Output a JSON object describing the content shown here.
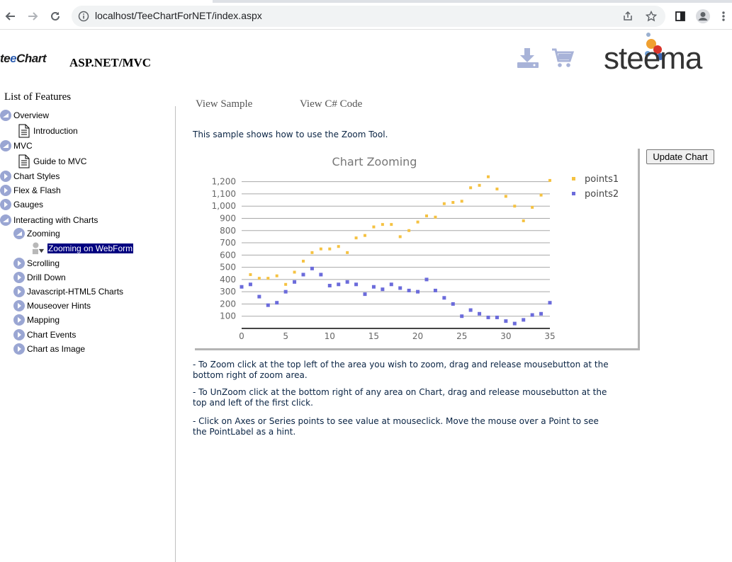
{
  "browser": {
    "url": "localhost/TeeChartForNET/index.aspx",
    "icons": [
      "back-icon",
      "forward-icon",
      "reload-icon",
      "info-icon",
      "share-icon",
      "star-icon",
      "sidepanel-icon",
      "profile-icon",
      "menu-icon"
    ]
  },
  "header": {
    "brand_prefix": "te",
    "brand_e": "e",
    "brand_suffix": "Chart",
    "subtitle": "ASP.NET/MVC",
    "company": "steema",
    "icons": [
      "download-icon",
      "cart-icon"
    ],
    "icon_color": "#a8b3d8"
  },
  "sidebar": {
    "title": "List of Features",
    "items": [
      {
        "label": "Overview",
        "icon": "collapse-icon"
      },
      {
        "label": "Introduction",
        "icon": "document-icon"
      },
      {
        "label": "MVC",
        "icon": "collapse-icon"
      },
      {
        "label": "Guide to MVC",
        "icon": "document-icon"
      },
      {
        "label": "Chart Styles",
        "icon": "expand-icon"
      },
      {
        "label": "Flex & Flash",
        "icon": "expand-icon"
      },
      {
        "label": "Gauges",
        "icon": "expand-icon"
      },
      {
        "label": "Interacting with Charts",
        "icon": "collapse-icon"
      },
      {
        "label": "Zooming",
        "icon": "collapse-icon"
      },
      {
        "label": "Zooming on WebForm",
        "icon": "sample-icon",
        "selected": true
      },
      {
        "label": "Scrolling",
        "icon": "expand-icon"
      },
      {
        "label": "Drill Down",
        "icon": "expand-icon"
      },
      {
        "label": "Javascript-HTML5 Charts",
        "icon": "expand-icon"
      },
      {
        "label": "Mouseover Hints",
        "icon": "expand-icon"
      },
      {
        "label": "Mapping",
        "icon": "expand-icon"
      },
      {
        "label": "Chart Events",
        "icon": "expand-icon"
      },
      {
        "label": "Chart as Image",
        "icon": "expand-icon"
      }
    ],
    "selected_bg": "#000080"
  },
  "content": {
    "tabs": [
      "View Sample",
      "View C# Code"
    ],
    "description": "This sample shows how to use the Zoom Tool.",
    "update_button": "Update Chart",
    "notes": [
      "- To Zoom click at the top left of the area you wish to zoom, drag and release mousebutton at the bottom right of zoom area.",
      "- To UnZoom click at the bottom right of any area on Chart, drag and release mousebutton at the top and left of the first click.",
      "- Click on Axes or Series points to see value at mouseclick. Move the mouse over a Point to see the PointLabel as a hint."
    ]
  },
  "chart_data": {
    "type": "scatter",
    "title": "Chart Zooming",
    "xlabel": "",
    "ylabel": "",
    "xlim": [
      0,
      35
    ],
    "ylim": [
      0,
      1250
    ],
    "x_ticks": [
      0,
      5,
      10,
      15,
      20,
      25,
      30,
      35
    ],
    "y_ticks": [
      100,
      200,
      300,
      400,
      500,
      600,
      700,
      800,
      900,
      1000,
      1100,
      1200
    ],
    "y_tick_labels": [
      "100",
      "200",
      "300",
      "400",
      "500",
      "600",
      "700",
      "800",
      "900",
      "1,000",
      "1,100",
      "1,200"
    ],
    "grid": true,
    "legend": "top-right",
    "x": [
      0,
      1,
      2,
      3,
      4,
      5,
      6,
      7,
      8,
      9,
      10,
      11,
      12,
      13,
      14,
      15,
      16,
      17,
      18,
      19,
      20,
      21,
      22,
      23,
      24,
      25,
      26,
      27,
      28,
      29,
      30,
      31,
      32,
      33,
      34,
      35
    ],
    "series": [
      {
        "name": "points1",
        "color": "#f5c242",
        "values": [
          340,
          440,
          410,
          410,
          430,
          360,
          460,
          550,
          620,
          650,
          650,
          670,
          620,
          740,
          760,
          830,
          850,
          850,
          750,
          800,
          870,
          920,
          910,
          1020,
          1030,
          1040,
          1150,
          1170,
          1240,
          1140,
          1080,
          1000,
          880,
          990,
          1090,
          1210
        ]
      },
      {
        "name": "points2",
        "color": "#6b6bdb",
        "values": [
          340,
          360,
          260,
          190,
          210,
          300,
          380,
          440,
          490,
          440,
          350,
          360,
          380,
          360,
          280,
          340,
          320,
          360,
          330,
          310,
          300,
          400,
          310,
          250,
          200,
          100,
          150,
          120,
          90,
          90,
          60,
          40,
          70,
          110,
          120,
          210
        ]
      }
    ]
  }
}
